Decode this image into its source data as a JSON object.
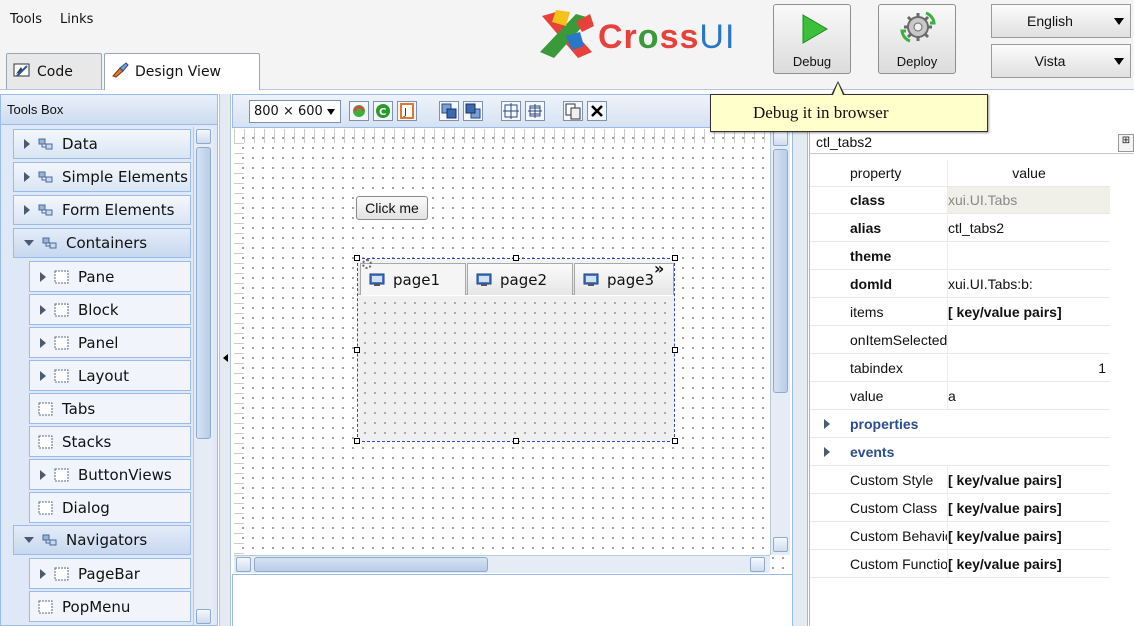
{
  "menu": {
    "tools": "Tools",
    "links": "Links"
  },
  "view_tabs": [
    {
      "label": "Code"
    },
    {
      "label": "Design View"
    }
  ],
  "logo": {
    "text_cross": "Cr",
    "text_o": "o",
    "text_ss": "ss",
    "text_ui": "UI"
  },
  "actions": {
    "debug": "Debug",
    "deploy": "Deploy"
  },
  "language": {
    "selected": "English"
  },
  "theme": {
    "selected": "Vista"
  },
  "tooltip": {
    "text": "Debug it in browser"
  },
  "toolsbox": {
    "title": "Tools Box",
    "items": [
      {
        "label": "Data",
        "kind": "cat",
        "state": "closed"
      },
      {
        "label": "Simple Elements",
        "kind": "cat",
        "state": "closed"
      },
      {
        "label": "Form Elements",
        "kind": "cat",
        "state": "closed"
      },
      {
        "label": "Containers",
        "kind": "cat",
        "state": "open"
      },
      {
        "label": "Pane",
        "kind": "sub"
      },
      {
        "label": "Block",
        "kind": "sub"
      },
      {
        "label": "Panel",
        "kind": "sub"
      },
      {
        "label": "Layout",
        "kind": "sub"
      },
      {
        "label": "Tabs",
        "kind": "plain"
      },
      {
        "label": "Stacks",
        "kind": "plain"
      },
      {
        "label": "ButtonViews",
        "kind": "sub"
      },
      {
        "label": "Dialog",
        "kind": "plain"
      },
      {
        "label": "Navigators",
        "kind": "cat",
        "state": "open"
      },
      {
        "label": "PageBar",
        "kind": "sub"
      },
      {
        "label": "PopMenu",
        "kind": "plain"
      }
    ]
  },
  "design": {
    "resolution": "800 × 600",
    "button_label": "Click me",
    "tabs": [
      {
        "label": "page1"
      },
      {
        "label": "page2"
      },
      {
        "label": "page3"
      }
    ],
    "tabs_more": "»"
  },
  "properties": {
    "title": "ctl_tabs2",
    "header": {
      "property": "property",
      "value": "value"
    },
    "rows": [
      {
        "key": "class",
        "value": "xui.UI.Tabs",
        "bold_key": true,
        "muted": true
      },
      {
        "key": "alias",
        "value": "ctl_tabs2",
        "bold_key": true
      },
      {
        "key": "theme",
        "value": "",
        "bold_key": true
      },
      {
        "key": "domId",
        "value": "xui.UI.Tabs:b:",
        "bold_key": true
      },
      {
        "key": "items",
        "value": "[ key/value pairs]"
      },
      {
        "key": "onItemSelected",
        "value": ""
      },
      {
        "key": "tabindex",
        "value": "1",
        "numeric": true
      },
      {
        "key": "value",
        "value": "a"
      },
      {
        "key": "properties",
        "value": "",
        "group": true
      },
      {
        "key": "events",
        "value": "",
        "group": true
      },
      {
        "key": "Custom Style",
        "value": "[ key/value pairs]"
      },
      {
        "key": "Custom Class",
        "value": "[ key/value pairs]"
      },
      {
        "key": "Custom Behaviors",
        "value": "[ key/value pairs]"
      },
      {
        "key": "Custom Functions",
        "value": "[ key/value pairs]"
      }
    ]
  },
  "colors": {
    "accent": "#99bbe8",
    "selection": "#3048d0",
    "tooltip_bg": "#ffffcc",
    "group_text": "#2b4e8c"
  },
  "icons": {
    "debug": "play-triangle-icon",
    "deploy": "gear-arrows-icon",
    "code_tab": "code-editor-icon",
    "design_tab": "design-brush-icon"
  }
}
